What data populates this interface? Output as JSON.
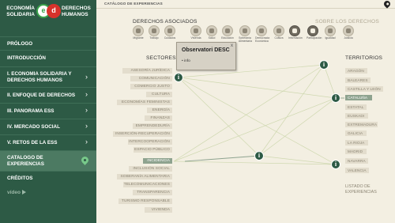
{
  "logo": {
    "left_text": "ECONOMÍA\nSOLIDARIA",
    "right_text": "DERECHOS\nHUMANOS",
    "left_glyph": "e",
    "right_glyph": "d"
  },
  "nav": [
    {
      "label": "PRÓLOGO",
      "chevron": false
    },
    {
      "label": "INTRODUCCIÓN",
      "chevron": false
    },
    {
      "label": "I. ECONOMIA SOLIDARIA Y DERECHOS HUMANOS",
      "chevron": true
    },
    {
      "label": "II. ENFOQUE DE DERECHOS",
      "chevron": true
    },
    {
      "label": "III. PANORAMA ESS",
      "chevron": true
    },
    {
      "label": "IV. MERCADO SOCIAL",
      "chevron": true
    },
    {
      "label": "V. RETOS DE LA ESS",
      "chevron": true
    },
    {
      "label": "CATALOGO DE EXPERIENCIAS",
      "chevron": false,
      "active": true
    },
    {
      "label": "CRÉDITOS",
      "chevron": false
    }
  ],
  "video_label": "vídeo",
  "topbar_title": "CATÁLOGO DE EXPERIENCIAS",
  "derechos_heading": "DERECHOS ASOCIADOS",
  "sobre_heading": "SOBRE LOS DERECHOS",
  "derechos": [
    {
      "label": "Migrante",
      "dark": false
    },
    {
      "label": "Trabajo",
      "dark": false
    },
    {
      "label": "Cuidados",
      "dark": false
    },
    {
      "label": "Vivienda",
      "dark": false
    },
    {
      "label": "Salud",
      "dark": false
    },
    {
      "label": "Educación",
      "dark": false
    },
    {
      "label": "Soberanía\nAlimentaria",
      "dark": false
    },
    {
      "label": "Democracia\nEconómica",
      "dark": false
    },
    {
      "label": "Cultura",
      "dark": false
    },
    {
      "label": "Información",
      "dark": true
    },
    {
      "label": "Participación",
      "dark": false
    },
    {
      "label": "Igualdad",
      "dark": false
    },
    {
      "label": "Justicia",
      "dark": false
    }
  ],
  "sectores_heading": "SECTORES",
  "sectores": [
    {
      "label": "ASESORÍA JURÍDICA",
      "hl": false
    },
    {
      "label": "COMUNICACIÓN",
      "hl": false
    },
    {
      "label": "COMERCIO JUSTO",
      "hl": false
    },
    {
      "label": "CULTURA",
      "hl": false
    },
    {
      "label": "ECONOMÍAS FEMINISTAS",
      "hl": false
    },
    {
      "label": "ENERGÍA",
      "hl": false
    },
    {
      "label": "FINANZAS",
      "hl": false
    },
    {
      "label": "EMPRENDEDURÍA",
      "hl": false
    },
    {
      "label": "INSERCIÓN-RECUPERACIÓN",
      "hl": false
    },
    {
      "label": "INTERCOOPERACIÓN",
      "hl": false
    },
    {
      "label": "ESPACIO PÚBLICO",
      "hl": false
    },
    {
      "label": "INCIDENCIA",
      "hl": true
    },
    {
      "label": "INCLUSIÓN SOCIAL",
      "hl": false
    },
    {
      "label": "SOBERANÍA ALIMENTARIA",
      "hl": false
    },
    {
      "label": "TELECOMUNICACIONES",
      "hl": false
    },
    {
      "label": "TRANSPARENCIA",
      "hl": false
    },
    {
      "label": "TURISMO RESPONSABLE",
      "hl": false
    },
    {
      "label": "VIVIENDA",
      "hl": false
    }
  ],
  "territorios_heading": "TERRITORIOS",
  "territorios": [
    {
      "label": "ARAGÓN",
      "hl": false
    },
    {
      "label": "BALEARES",
      "hl": false
    },
    {
      "label": "CASTILLA Y LEÓN",
      "hl": false
    },
    {
      "label": "CATALUÑA",
      "hl": true
    },
    {
      "label": "ESTATAL",
      "hl": false
    },
    {
      "label": "EUSKADI",
      "hl": false
    },
    {
      "label": "EXTREMADURA",
      "hl": false
    },
    {
      "label": "GALICIA",
      "hl": false
    },
    {
      "label": "LA RIOJA",
      "hl": false
    },
    {
      "label": "MADRID",
      "hl": false
    },
    {
      "label": "NAVARRA",
      "hl": false
    },
    {
      "label": "VALENCIA",
      "hl": false
    }
  ],
  "listado": "LISTADO DE\nEXPERIENCIAS",
  "popup": {
    "title": "Observatori DESC",
    "close": "x",
    "info": "info"
  },
  "node_glyph": "i"
}
